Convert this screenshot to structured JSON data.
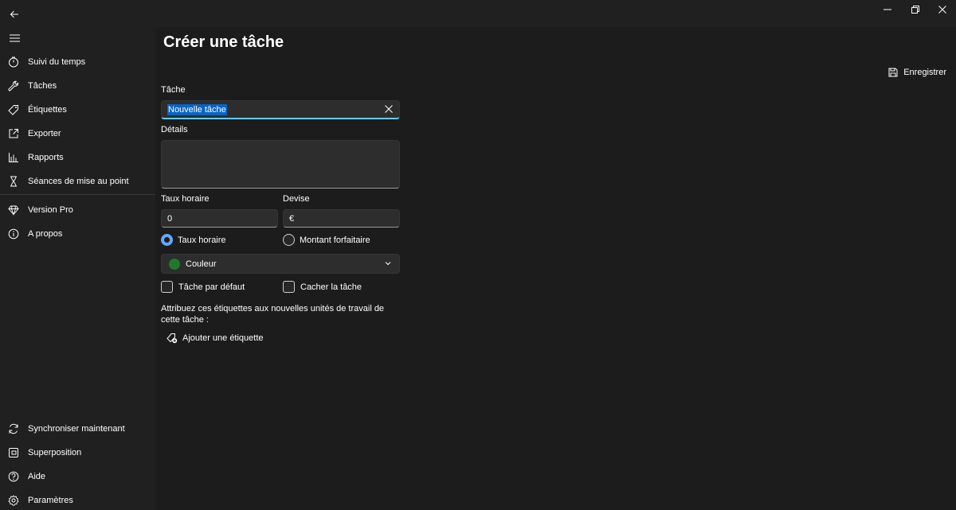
{
  "sidebar": {
    "top_items": [
      {
        "label": "Suivi du temps",
        "icon": "timer-icon"
      },
      {
        "label": "Tâches",
        "icon": "wrench-icon"
      },
      {
        "label": "Étiquettes",
        "icon": "tag-icon"
      },
      {
        "label": "Exporter",
        "icon": "export-icon"
      },
      {
        "label": "Rapports",
        "icon": "bar-chart-icon"
      },
      {
        "label": "Séances de mise au point",
        "icon": "hourglass-icon"
      }
    ],
    "middle_items": [
      {
        "label": "Version Pro",
        "icon": "diamond-icon"
      },
      {
        "label": "A propos",
        "icon": "info-icon"
      }
    ],
    "bottom_items": [
      {
        "label": "Synchroniser maintenant",
        "icon": "sync-icon"
      },
      {
        "label": "Superposition",
        "icon": "overlay-icon"
      },
      {
        "label": "Aide",
        "icon": "help-icon"
      },
      {
        "label": "Paramètres",
        "icon": "gear-icon"
      }
    ]
  },
  "page": {
    "title": "Créer une tâche",
    "save_label": "Enregistrer"
  },
  "form": {
    "task_label": "Tâche",
    "task_value": "Nouvelle tâche",
    "details_label": "Détails",
    "details_value": "",
    "rate_label": "Taux horaire",
    "rate_value": "0",
    "currency_label": "Devise",
    "currency_value": "€",
    "billing_options": [
      {
        "label": "Taux horaire",
        "checked": true
      },
      {
        "label": "Montant forfaitaire",
        "checked": false
      }
    ],
    "color_label": "Couleur",
    "color_value": "#1e7a2a",
    "default_task_label": "Tâche par défaut",
    "hide_task_label": "Cacher la tâche",
    "tags_description": "Attribuez ces étiquettes aux nouvelles unités de travail de cette tâche :",
    "add_tag_label": "Ajouter une étiquette"
  },
  "colors": {
    "accent": "#60cdff",
    "selection": "#0a64c2",
    "radio_checked": "#60a8ff"
  }
}
